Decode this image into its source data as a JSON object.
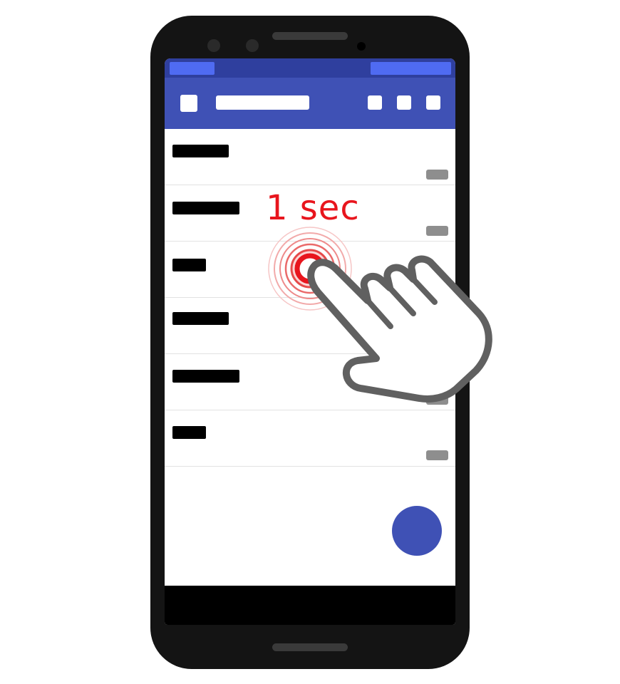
{
  "hint": {
    "text": "1 sec"
  },
  "colors": {
    "primary": "#3f51b5",
    "primary_dark": "#2f3f9e",
    "accent": "#4f6bf2",
    "touch_red": "#e8151d",
    "meta_gray": "#8e8e8e"
  },
  "icons": {
    "toolbar_nav": "square-placeholder-icon",
    "toolbar_actions": [
      "square-placeholder-icon",
      "square-placeholder-icon",
      "square-placeholder-icon"
    ],
    "gesture": "pointing-hand-icon",
    "touch": "touch-ripple-icon",
    "fab": "floating-action-button"
  },
  "gesture": {
    "type": "long-press",
    "target_list_item_index": 2
  }
}
